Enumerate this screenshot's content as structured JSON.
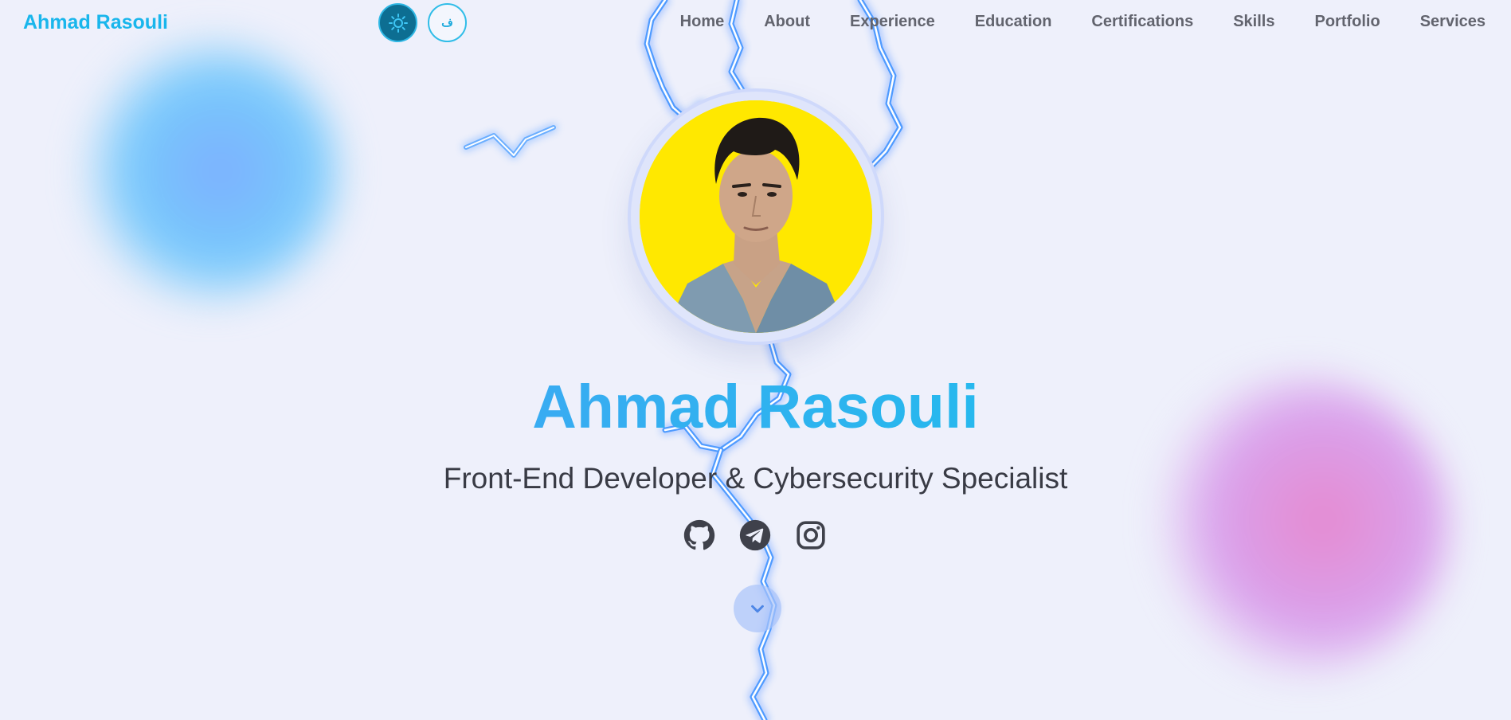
{
  "nav": {
    "brand": "Ahmad Rasouli",
    "theme_toggle_icon": "sun-icon",
    "language_toggle_label": "ف",
    "links": [
      {
        "label": "Home"
      },
      {
        "label": "About"
      },
      {
        "label": "Experience"
      },
      {
        "label": "Education"
      },
      {
        "label": "Certifications"
      },
      {
        "label": "Skills"
      },
      {
        "label": "Portfolio"
      },
      {
        "label": "Services"
      }
    ]
  },
  "hero": {
    "avatar_alt": "profile-photo",
    "name": "Ahmad Rasouli",
    "subtitle": "Front-End Developer & Cybersecurity Specialist",
    "socials": [
      {
        "icon": "github-icon"
      },
      {
        "icon": "telegram-icon"
      },
      {
        "icon": "instagram-icon"
      }
    ],
    "scroll_icon": "chevron-down-icon"
  },
  "colors": {
    "accent": "#19b6ec",
    "nav_text": "#62646e",
    "subtitle_text": "#393b45",
    "background": "#eef0fb",
    "avatar_bg": "#ffe800"
  }
}
